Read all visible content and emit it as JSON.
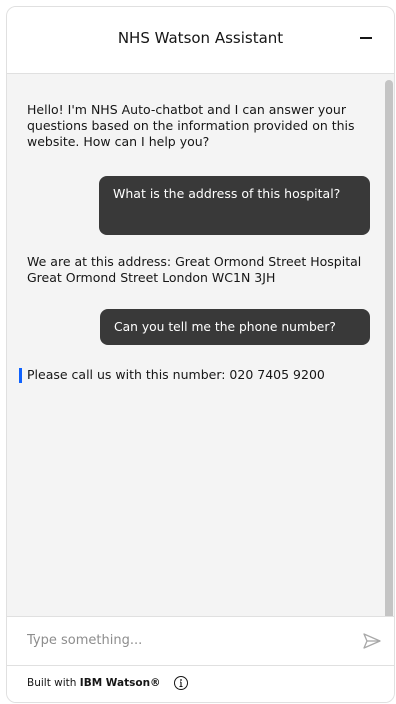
{
  "header": {
    "title": "NHS Watson Assistant",
    "minimize_icon": "minus-icon"
  },
  "messages": [
    {
      "role": "bot",
      "text": "Hello! I'm NHS Auto-chatbot and I can answer your questions based on the information provided on this website. How can I help you?"
    },
    {
      "role": "user",
      "text": "What is the address of this hospital?"
    },
    {
      "role": "bot",
      "text": "We are at this address: Great Ormond Street Hospital Great Ormond Street London WC1N 3JH"
    },
    {
      "role": "user",
      "text": "Can you tell me the phone number?"
    },
    {
      "role": "bot",
      "text": "Please call us with this number: 020 7405 9200"
    }
  ],
  "input": {
    "value": "",
    "placeholder": "Type something..."
  },
  "footer": {
    "built_with": "Built with",
    "brand": "IBM Watson®",
    "info_icon": "info-icon"
  },
  "colors": {
    "user_bubble": "#393939",
    "focus_indicator": "#0f62fe",
    "background": "#f4f4f4"
  }
}
